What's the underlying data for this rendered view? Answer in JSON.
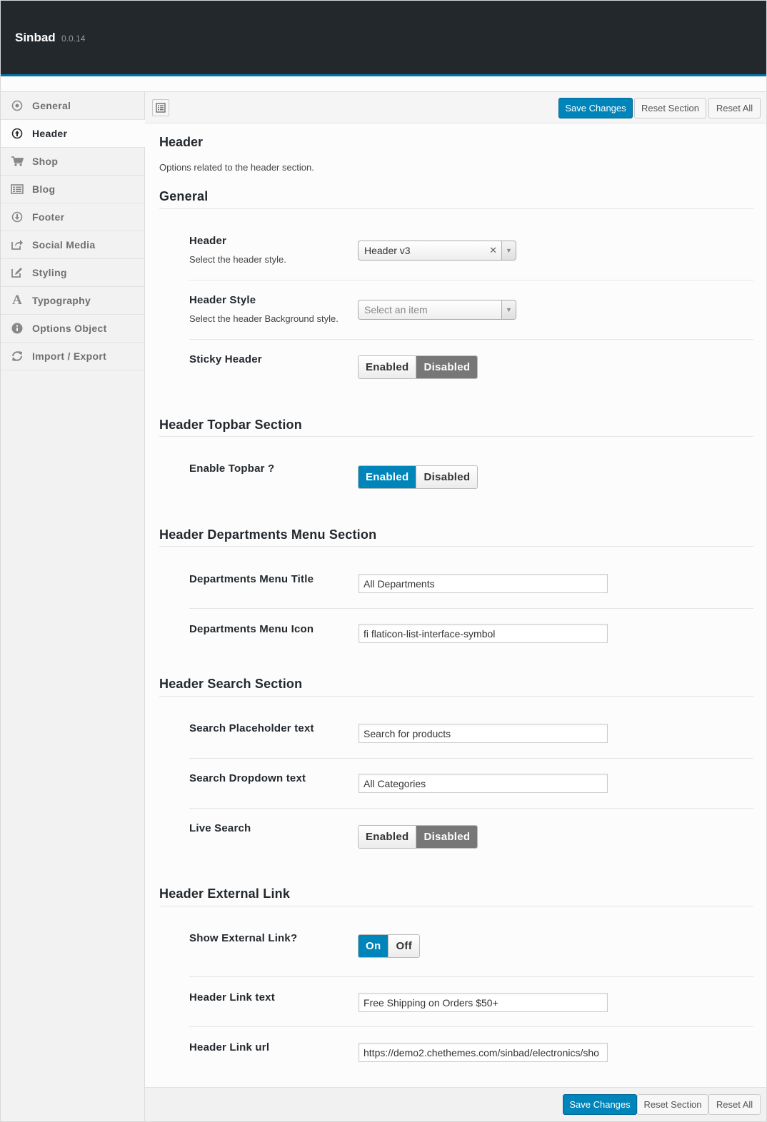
{
  "app": {
    "title": "Sinbad",
    "version": "0.0.14"
  },
  "sidebar": {
    "items": [
      {
        "label": "General",
        "icon": "circle-dot-icon",
        "active": false
      },
      {
        "label": "Header",
        "icon": "arrow-up-circle-icon",
        "active": true
      },
      {
        "label": "Shop",
        "icon": "cart-icon",
        "active": false
      },
      {
        "label": "Blog",
        "icon": "list-icon",
        "active": false
      },
      {
        "label": "Footer",
        "icon": "arrow-down-circle-icon",
        "active": false
      },
      {
        "label": "Social Media",
        "icon": "share-icon",
        "active": false
      },
      {
        "label": "Styling",
        "icon": "edit-icon",
        "active": false
      },
      {
        "label": "Typography",
        "icon": "font-icon",
        "active": false
      },
      {
        "label": "Options Object",
        "icon": "info-icon",
        "active": false
      },
      {
        "label": "Import / Export",
        "icon": "refresh-icon",
        "active": false
      }
    ]
  },
  "toolbar": {
    "save_label": "Save Changes",
    "reset_section_label": "Reset Section",
    "reset_all_label": "Reset All"
  },
  "page": {
    "title": "Header",
    "description": "Options related to the header section."
  },
  "sections": {
    "general": {
      "title": "General",
      "header": {
        "label": "Header",
        "desc": "Select the header style.",
        "value": "Header v3"
      },
      "header_style": {
        "label": "Header Style",
        "desc": "Select the header Background style.",
        "placeholder": "Select an item"
      },
      "sticky_header": {
        "label": "Sticky Header",
        "enabled": "Enabled",
        "disabled": "Disabled",
        "selected": "Disabled"
      }
    },
    "topbar": {
      "title": "Header Topbar Section",
      "enable_topbar": {
        "label": "Enable Topbar ?",
        "enabled": "Enabled",
        "disabled": "Disabled",
        "selected": "Enabled"
      }
    },
    "departments": {
      "title": "Header Departments Menu Section",
      "menu_title": {
        "label": "Departments Menu Title",
        "value": "All Departments"
      },
      "menu_icon": {
        "label": "Departments Menu Icon",
        "value": "fi flaticon-list-interface-symbol"
      }
    },
    "search": {
      "title": "Header Search Section",
      "placeholder_text": {
        "label": "Search Placeholder text",
        "value": "Search for products"
      },
      "dropdown_text": {
        "label": "Search Dropdown text",
        "value": "All Categories"
      },
      "live_search": {
        "label": "Live Search",
        "enabled": "Enabled",
        "disabled": "Disabled",
        "selected": "Disabled"
      }
    },
    "external": {
      "title": "Header External Link",
      "show_link": {
        "label": "Show External Link?",
        "on": "On",
        "off": "Off",
        "selected": "On"
      },
      "link_text": {
        "label": "Header Link text",
        "value": "Free Shipping on Orders $50+"
      },
      "link_url": {
        "label": "Header Link url",
        "value": "https://demo2.chethemes.com/sinbad/electronics/sho"
      }
    }
  },
  "colors": {
    "accent": "#0085ba",
    "topbar": "#23282d",
    "toggle_off": "#777777"
  }
}
